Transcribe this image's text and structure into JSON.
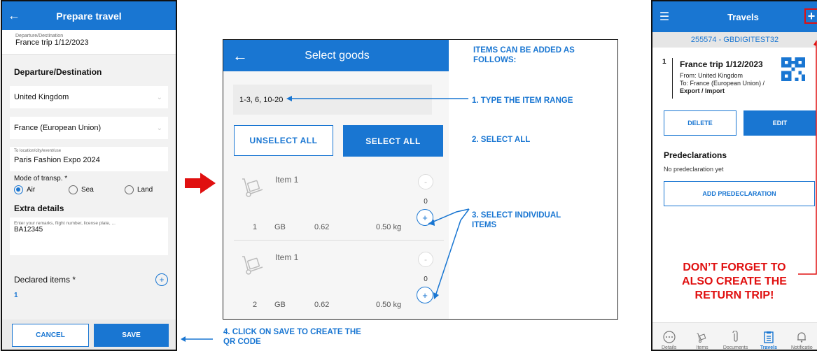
{
  "colors": {
    "accent": "#1976d2",
    "warning": "#e01010"
  },
  "prepare": {
    "title": "Prepare travel",
    "back_icon": "arrow-left-icon",
    "top_label": "Departure/Destination",
    "top_value": "France trip 1/12/2023",
    "section_dep": "Departure/Destination",
    "departure": "United Kingdom",
    "destination": "France (European Union)",
    "location_label": "To location/city/event/use",
    "location_value": "Paris Fashion Expo 2024",
    "mode_label": "Mode of transp. *",
    "modes": [
      {
        "label": "Air",
        "selected": true
      },
      {
        "label": "Sea",
        "selected": false
      },
      {
        "label": "Land",
        "selected": false
      }
    ],
    "extra_title": "Extra details",
    "extra_placeholder": "Enter your remarks, flight number, license plate, ...",
    "extra_value": "BA12345",
    "declared_title": "Declared items *",
    "declared_value": "1",
    "cancel": "CANCEL",
    "save": "SAVE"
  },
  "select": {
    "title": "Select goods",
    "range_value": "1-3, 6, 10-20",
    "unselect_all": "UNSELECT ALL",
    "select_all": "SELECT ALL",
    "items": [
      {
        "name": "Item 1",
        "qty": "0",
        "index": "1",
        "country": "GB",
        "value": "0.62",
        "weight": "0.50 kg"
      },
      {
        "name": "Item 1",
        "qty": "0",
        "index": "2",
        "country": "GB",
        "value": "0.62",
        "weight": "0.50 kg"
      }
    ]
  },
  "notes": {
    "intro": "ITEMS CAN BE ADDED AS FOLLOWS:",
    "step1": "1.  TYPE THE ITEM RANGE",
    "step2": "2.  SELECT ALL",
    "step3": "3.  SELECT INDIVIDUAL ITEMS",
    "step4": "4. CLICK ON SAVE TO CREATE THE QR CODE",
    "warning": "DON’T  FORGET TO ALSO CREATE THE RETURN TRIP!"
  },
  "travels": {
    "title": "Travels",
    "subtitle": "255574 - GBDIGITEST32",
    "trip_number": "1",
    "trip_title": "France trip 1/12/2023",
    "from": "From: United Kingdom",
    "to": "To: France (European Union) /",
    "type": "Export / Import",
    "delete": "DELETE",
    "edit": "EDIT",
    "predecl_title": "Predeclarations",
    "predecl_none": "No predeclaration yet",
    "add_predecl": "ADD PREDECLARATION",
    "tabs": [
      {
        "label": "Details",
        "icon": "more-horizontal-icon"
      },
      {
        "label": "Items",
        "icon": "hand-truck-icon"
      },
      {
        "label": "Documents",
        "icon": "paperclip-icon"
      },
      {
        "label": "Travels",
        "icon": "clipboard-icon",
        "active": true
      },
      {
        "label": "Notificatio",
        "icon": "bell-icon"
      }
    ]
  }
}
